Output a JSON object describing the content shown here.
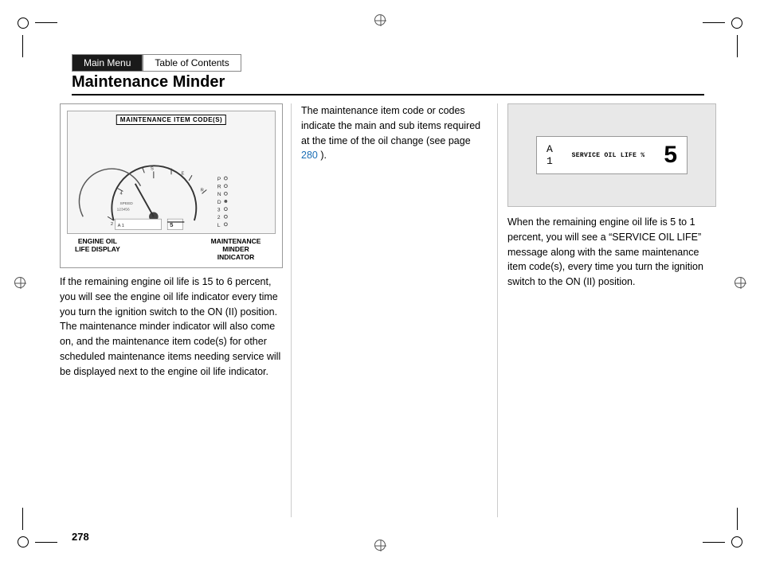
{
  "page": {
    "title": "Maintenance Minder",
    "number": "278"
  },
  "nav": {
    "main_menu": "Main Menu",
    "table_of_contents": "Table of Contents"
  },
  "left_column": {
    "cluster_label": "MAINTENANCE ITEM CODE(S)",
    "engine_oil_label": "ENGINE OIL\nLIFE DISPLAY",
    "minder_label": "MAINTENANCE\nMINDER INDICATOR",
    "body_text": "If the remaining engine oil life is 15 to 6 percent, you will see the engine oil life indicator every time you turn the ignition switch to the ON (II) position. The maintenance minder indicator will also come on, and the maintenance item code(s) for other scheduled maintenance items needing service will be displayed next to the engine oil life indicator."
  },
  "mid_column": {
    "text": "The maintenance item code or codes indicate the main and sub items required at the time of the oil change (see page ",
    "page_link": "280",
    "text_suffix": " )."
  },
  "right_column": {
    "service_oil_label": "SERVICE OIL LIFE %",
    "display_left_top": "A",
    "display_left_bot": "1",
    "display_right": "5",
    "body_text": "When the remaining engine oil life is 5 to 1 percent, you will see a “SERVICE OIL LIFE” message along with the same maintenance item code(s), every time you turn the ignition switch to the ON (II) position."
  }
}
